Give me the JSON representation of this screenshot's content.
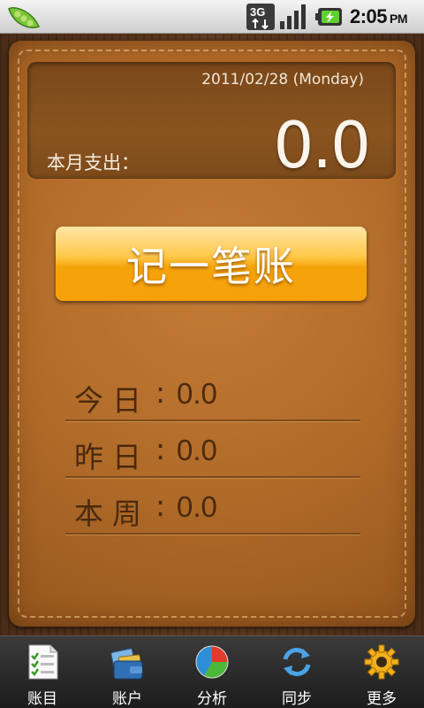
{
  "status_bar": {
    "network": "3G",
    "time": "2:05",
    "ampm": "PM"
  },
  "summary": {
    "date": "2011/02/28  (Monday)",
    "month_label": "本月支出：",
    "month_value": "0.0"
  },
  "record_button": "记一笔账",
  "stats": [
    {
      "label": "今日",
      "colon": ":",
      "value": "0.0"
    },
    {
      "label": "昨日",
      "colon": ":",
      "value": "0.0"
    },
    {
      "label": "本周",
      "colon": ":",
      "value": "0.0"
    }
  ],
  "tabs": [
    {
      "label": "账目",
      "icon": "list-icon"
    },
    {
      "label": "账户",
      "icon": "wallet-icon"
    },
    {
      "label": "分析",
      "icon": "pie-chart-icon"
    },
    {
      "label": "同步",
      "icon": "sync-icon"
    },
    {
      "label": "更多",
      "icon": "gear-icon"
    }
  ],
  "colors": {
    "button": "#f6a30a",
    "leather": "#b06a28",
    "text_dark": "#4a2a0e"
  }
}
